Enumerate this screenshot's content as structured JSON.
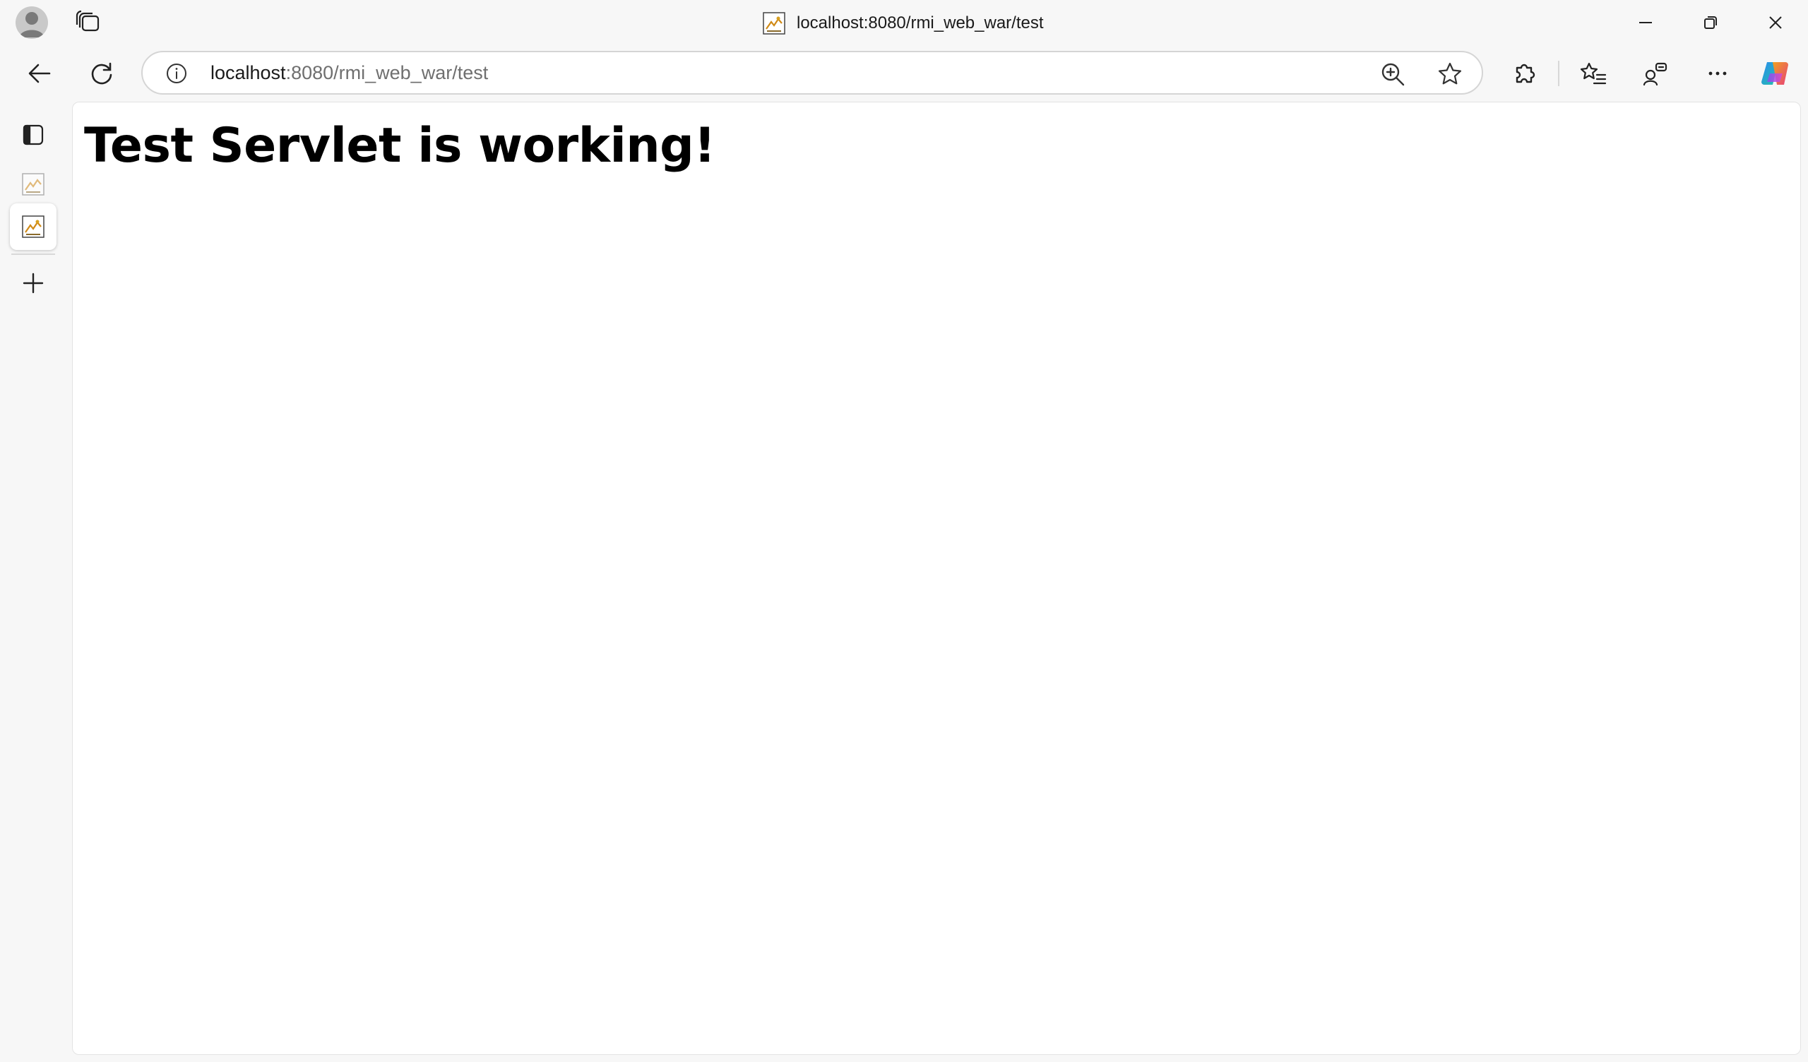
{
  "window": {
    "title": "localhost:8080/rmi_web_war/test",
    "controls": [
      "minimize",
      "restore",
      "close"
    ]
  },
  "toolbar": {
    "url_host": "localhost",
    "url_rest": ":8080/rmi_web_war/test",
    "icons": [
      "back-icon",
      "refresh-icon",
      "site-info-icon",
      "zoom-icon",
      "favorite-star-icon",
      "extensions-icon",
      "favorites-icon",
      "profile-sync-icon",
      "more-icon",
      "copilot-icon"
    ]
  },
  "sidebar": {
    "items": [
      "tab-actions",
      "tab-inactive",
      "tab-active",
      "new-tab"
    ]
  },
  "page": {
    "heading": "Test Servlet is working!"
  },
  "colors": {
    "chrome_bg": "#f7f7f7",
    "page_bg": "#ffffff",
    "text": "#000000"
  }
}
